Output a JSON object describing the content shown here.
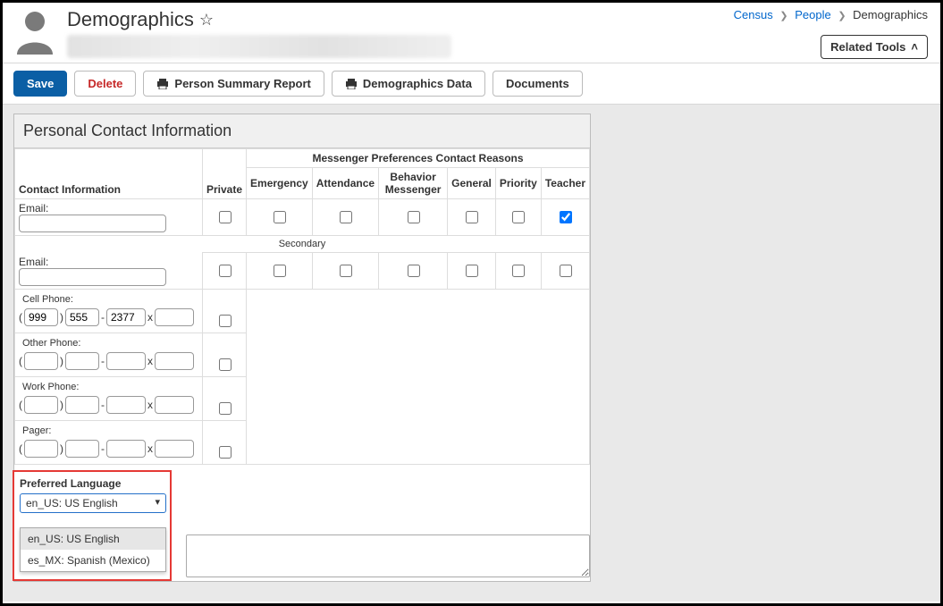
{
  "header": {
    "title": "Demographics",
    "breadcrumb": {
      "a": "Census",
      "b": "People",
      "c": "Demographics"
    },
    "related_tools": "Related Tools"
  },
  "toolbar": {
    "save": "Save",
    "delete": "Delete",
    "person_summary": "Person Summary Report",
    "demographics_data": "Demographics Data",
    "documents": "Documents"
  },
  "panel": {
    "title": "Personal Contact Information",
    "group_header": "Messenger Preferences Contact Reasons",
    "col_contact": "Contact Information",
    "col_private": "Private",
    "cols": [
      "Emergency",
      "Attendance",
      "Behavior Messenger",
      "General",
      "Priority",
      "Teacher"
    ],
    "rows": {
      "email": {
        "label": "Email:",
        "value": "",
        "checks": [
          false,
          false,
          false,
          false,
          false,
          true
        ],
        "private": false
      },
      "secondary_label": "Secondary",
      "email2": {
        "label": "Email:",
        "value": "",
        "checks": [
          false,
          false,
          false,
          false,
          false,
          false
        ],
        "private": false
      },
      "cell": {
        "label": "Cell Phone:",
        "p1": "999",
        "p2": "555",
        "p3": "2377",
        "p4": "",
        "private": false
      },
      "other": {
        "label": "Other Phone:",
        "p1": "",
        "p2": "",
        "p3": "",
        "p4": "",
        "private": false
      },
      "work": {
        "label": "Work Phone:",
        "p1": "",
        "p2": "",
        "p3": "",
        "p4": "",
        "private": false
      },
      "pager": {
        "label": "Pager:",
        "p1": "",
        "p2": "",
        "p3": "",
        "p4": "",
        "private": false
      }
    }
  },
  "preferred": {
    "label": "Preferred Language",
    "selected": "en_US: US English",
    "options": [
      "en_US: US English",
      "es_MX: Spanish (Mexico)"
    ]
  }
}
